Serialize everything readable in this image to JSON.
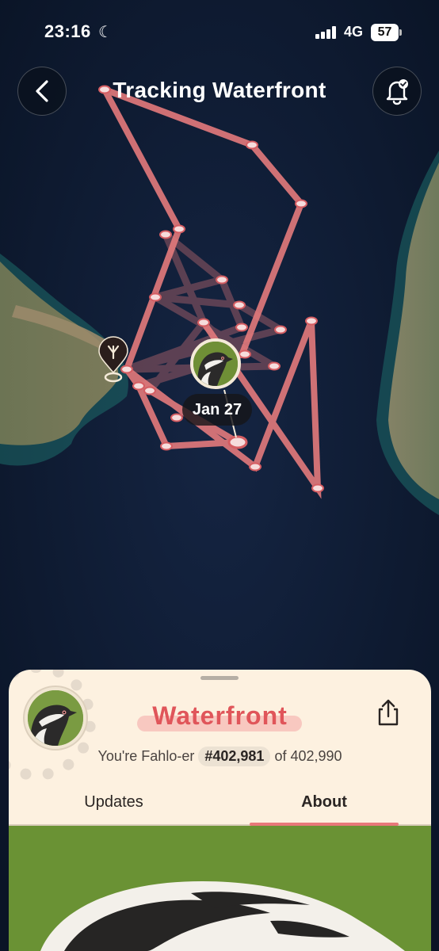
{
  "status_bar": {
    "time": "23:16",
    "moon_icon": "moon-icon",
    "network": "4G",
    "battery": "57"
  },
  "header": {
    "title": "Tracking Waterfront",
    "back_icon": "chevron-left-icon",
    "bell_icon": "bell-check-icon"
  },
  "map": {
    "date_label": "Jan 27",
    "route_color": "#e47a7c",
    "water_color": "#0d1a30",
    "land_color": "#5f6d4f",
    "origin_icon": "footprint-pin-icon"
  },
  "profile": {
    "name": "Waterfront",
    "rank_prefix": "You're Fahlo-er",
    "rank": "#402,981",
    "rank_of": "of 402,990",
    "share_icon": "share-icon",
    "accent_color": "#e0555a"
  },
  "tabs": [
    {
      "label": "Updates",
      "active": false
    },
    {
      "label": "About",
      "active": true
    }
  ]
}
